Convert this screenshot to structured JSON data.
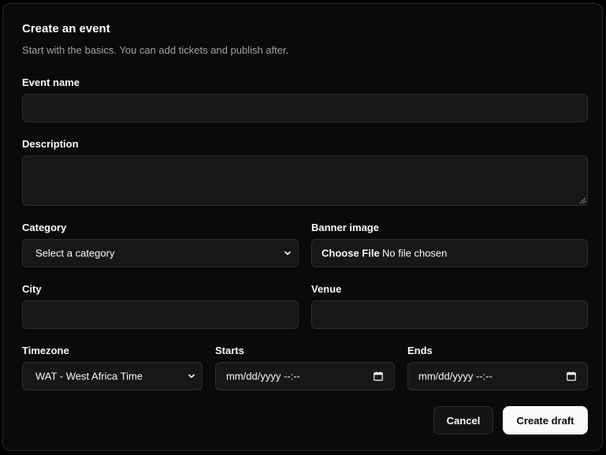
{
  "dialog": {
    "title": "Create an event",
    "subtitle": "Start with the basics. You can add tickets and publish after."
  },
  "form": {
    "event_name": {
      "label": "Event name",
      "value": ""
    },
    "description": {
      "label": "Description",
      "value": ""
    },
    "category": {
      "label": "Category",
      "selected": "Select a category"
    },
    "banner_image": {
      "label": "Banner image",
      "button_label": "Choose File",
      "status": "No file chosen"
    },
    "city": {
      "label": "City",
      "value": ""
    },
    "venue": {
      "label": "Venue",
      "value": ""
    },
    "timezone": {
      "label": "Timezone",
      "selected": "WAT - West Africa Time"
    },
    "starts": {
      "label": "Starts",
      "placeholder": "mm/dd/yyyy --:--"
    },
    "ends": {
      "label": "Ends",
      "placeholder": "mm/dd/yyyy --:--"
    }
  },
  "actions": {
    "cancel_label": "Cancel",
    "submit_label": "Create draft"
  },
  "icons": {
    "select_chevron": "chevron-down-icon",
    "date_picker": "calendar-icon",
    "textarea_resize": "resize-grip-icon"
  },
  "colors": {
    "background": "#0a0a0a",
    "field_background": "#171717",
    "border": "#2e2e2e",
    "muted_text": "#a1a1a1",
    "primary_button": "#fafafa"
  }
}
